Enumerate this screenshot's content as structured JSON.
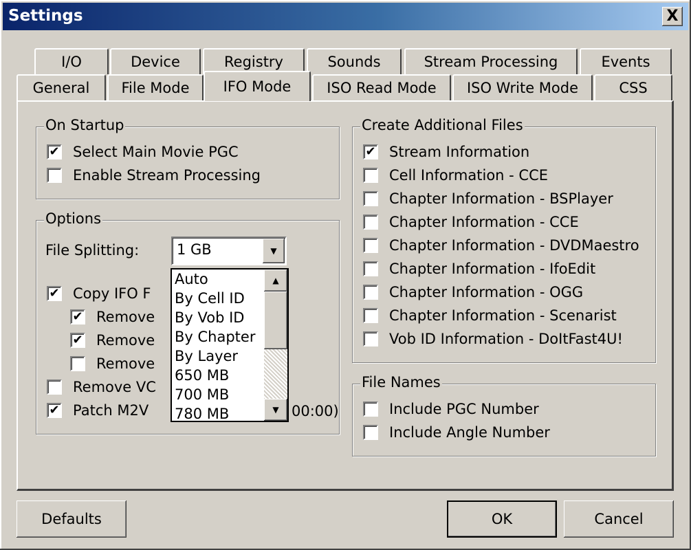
{
  "window": {
    "title": "Settings",
    "close_label": "X"
  },
  "tabs": {
    "row_back": [
      {
        "label": "I/O"
      },
      {
        "label": "Device"
      },
      {
        "label": "Registry"
      },
      {
        "label": "Sounds"
      },
      {
        "label": "Stream Processing"
      },
      {
        "label": "Events"
      }
    ],
    "row_front": [
      {
        "label": "General"
      },
      {
        "label": "File Mode"
      },
      {
        "label": "IFO Mode",
        "active": true
      },
      {
        "label": "ISO Read Mode"
      },
      {
        "label": "ISO Write Mode"
      },
      {
        "label": "CSS"
      }
    ]
  },
  "on_startup": {
    "legend": "On Startup",
    "items": [
      {
        "label": "Select Main Movie PGC",
        "checked": true
      },
      {
        "label": "Enable Stream Processing",
        "checked": false
      }
    ]
  },
  "options": {
    "legend": "Options",
    "file_splitting_label": "File Splitting:",
    "file_splitting_value": "1 GB",
    "dropdown_options": [
      "Auto",
      "By Cell ID",
      "By Vob ID",
      "By Chapter",
      "By Layer",
      "650 MB",
      "700 MB",
      "780 MB"
    ],
    "items": [
      {
        "label": "Copy IFO F",
        "checked": true
      },
      {
        "label": "Remove",
        "checked": true
      },
      {
        "label": "Remove",
        "checked": true
      },
      {
        "label": "Remove",
        "checked": false
      },
      {
        "label": "Remove VC",
        "checked": false
      },
      {
        "label": "Patch M2V",
        "checked": true
      }
    ],
    "patch_suffix": "00:00)"
  },
  "additional_files": {
    "legend": "Create Additional Files",
    "items": [
      {
        "label": "Stream Information",
        "checked": true
      },
      {
        "label": "Cell Information - CCE",
        "checked": false
      },
      {
        "label": "Chapter Information - BSPlayer",
        "checked": false
      },
      {
        "label": "Chapter Information - CCE",
        "checked": false
      },
      {
        "label": "Chapter Information - DVDMaestro",
        "checked": false
      },
      {
        "label": "Chapter Information - IfoEdit",
        "checked": false
      },
      {
        "label": "Chapter Information - OGG",
        "checked": false
      },
      {
        "label": "Chapter Information - Scenarist",
        "checked": false
      },
      {
        "label": "Vob ID Information - DoItFast4U!",
        "checked": false
      }
    ]
  },
  "file_names": {
    "legend": "File Names",
    "items": [
      {
        "label": "Include PGC Number",
        "checked": false
      },
      {
        "label": "Include Angle Number",
        "checked": false
      }
    ]
  },
  "buttons": {
    "defaults": "Defaults",
    "ok": "OK",
    "cancel": "Cancel"
  },
  "check_glyph": "✔"
}
